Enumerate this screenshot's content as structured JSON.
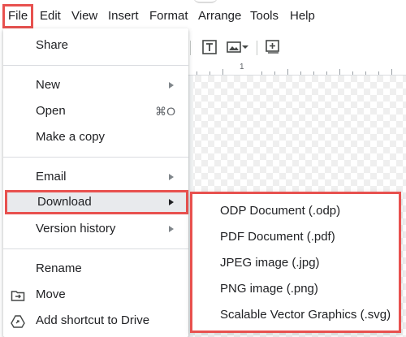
{
  "menubar": {
    "items": [
      "File",
      "Edit",
      "View",
      "Insert",
      "Format",
      "Arrange",
      "Tools",
      "Help"
    ],
    "active": "File"
  },
  "ruler": {
    "label": "1"
  },
  "toolbar": {
    "icons": [
      "textbox-icon",
      "image-icon",
      "chevron-down-icon",
      "new-slide-icon"
    ]
  },
  "file_menu": {
    "share": "Share",
    "new": "New",
    "open": "Open",
    "open_shortcut": "⌘O",
    "make_copy": "Make a copy",
    "email": "Email",
    "download": "Download",
    "version_history": "Version history",
    "rename": "Rename",
    "move": "Move",
    "add_shortcut": "Add shortcut to Drive"
  },
  "download_submenu": {
    "items": [
      "ODP Document (.odp)",
      "PDF Document (.pdf)",
      "JPEG image (.jpg)",
      "PNG image (.png)",
      "Scalable Vector Graphics (.svg)"
    ]
  },
  "colors": {
    "highlight_border": "#e8514f",
    "hover_bg": "#e8eaed",
    "text": "#202124",
    "muted": "#5f6368"
  }
}
